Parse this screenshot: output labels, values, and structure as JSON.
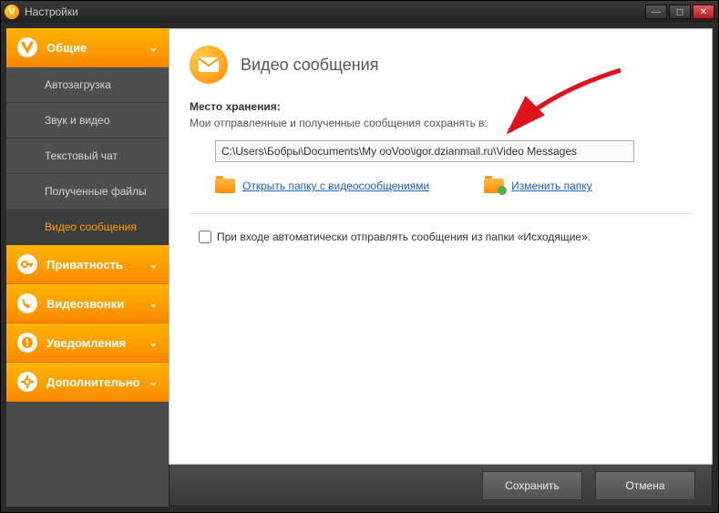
{
  "window": {
    "title": "Настройки"
  },
  "sidebar": {
    "general": {
      "label": "Общие"
    },
    "subs": {
      "autoload": "Автозагрузка",
      "sound_video": "Звук и видео",
      "text_chat": "Текстовый чат",
      "received_files": "Полученные файлы",
      "video_messages": "Видео сообщения"
    },
    "privacy": {
      "label": "Приватность"
    },
    "videocalls": {
      "label": "Видеозвонки"
    },
    "notifications": {
      "label": "Уведомления"
    },
    "advanced": {
      "label": "Дополнительно"
    }
  },
  "content": {
    "header_title": "Видео сообщения",
    "storage_label": "Место хранения:",
    "storage_desc": "Мои отправленные и полученные сообщения сохранять в:",
    "path_value": "C:\\Users\\Бобры\\Documents\\My ooVoo\\igor.dzianmail.ru\\Video Messages",
    "open_folder_link": "Открыть папку с видеосообщениями",
    "change_folder_link": "Изменить папку",
    "checkbox_label": "При входе автоматически отправлять сообщения из папки «Исходящие»."
  },
  "footer": {
    "save": "Сохранить",
    "cancel": "Отмена"
  }
}
